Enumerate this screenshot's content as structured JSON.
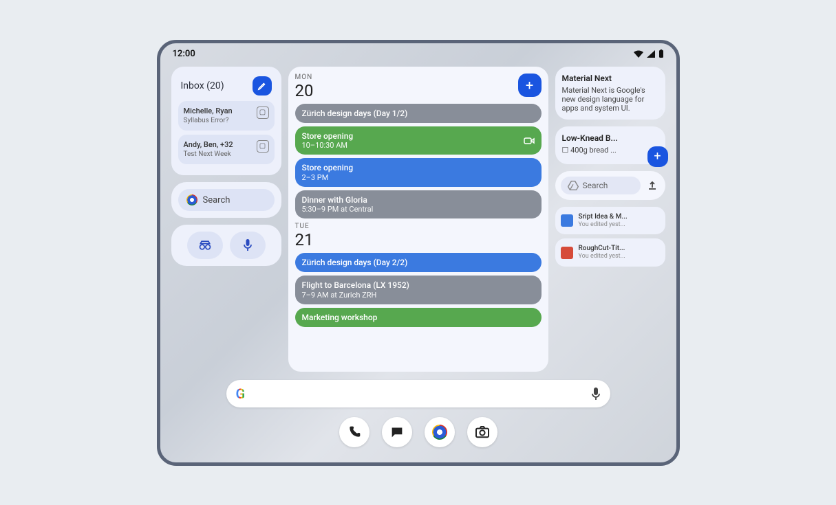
{
  "status": {
    "time": "12:00"
  },
  "inbox": {
    "title": "Inbox (20)",
    "items": [
      {
        "from": "Michelle, Ryan",
        "subject": "Syllabus Error?"
      },
      {
        "from": "Andy, Ben, +32",
        "subject": "Test Next Week"
      }
    ]
  },
  "chrome": {
    "search_label": "Search"
  },
  "calendar": {
    "days": [
      {
        "dow": "MON",
        "num": "20",
        "events": [
          {
            "title": "Zürich design days (Day 1/2)",
            "time": "",
            "color": "ev-gray"
          },
          {
            "title": "Store opening",
            "time": "10–10:30 AM",
            "color": "ev-green",
            "video": true
          },
          {
            "title": "Store opening",
            "time": "2–3 PM",
            "color": "ev-blue"
          },
          {
            "title": "Dinner with Gloria",
            "time": "5:30–9 PM at Central",
            "color": "ev-gray"
          }
        ]
      },
      {
        "dow": "TUE",
        "num": "21",
        "events": [
          {
            "title": "Zürich design days (Day 2/2)",
            "time": "",
            "color": "ev-blue"
          },
          {
            "title": "Flight to Barcelona (LX 1952)",
            "time": "7–9 AM at Zurich ZRH",
            "color": "ev-gray"
          },
          {
            "title": "Marketing workshop",
            "time": "",
            "color": "ev-green"
          }
        ]
      }
    ]
  },
  "notes": {
    "material": {
      "title": "Material Next",
      "body": "Material Next is Google's new design language for apps and system UI."
    },
    "recipe": {
      "title": "Low-Knead B...",
      "item1": "400g bread ..."
    }
  },
  "drive": {
    "search_label": "Search",
    "docs": [
      {
        "title": "Sript Idea & M...",
        "sub": "You edited yest..."
      },
      {
        "title": "RoughCut-Tit...",
        "sub": "You edited yest..."
      }
    ]
  }
}
